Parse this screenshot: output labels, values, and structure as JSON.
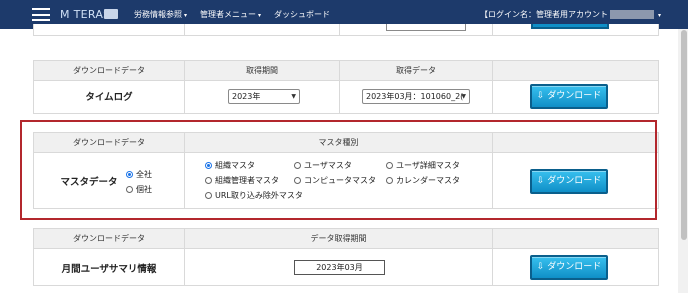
{
  "header": {
    "brand": "M TERAS",
    "nav": [
      {
        "label": "労務情報参照"
      },
      {
        "label": "管理者メニュー"
      },
      {
        "label": "ダッシュボード"
      }
    ],
    "login_label": "【ログイン名：管理者用アカウント"
  },
  "timelog": {
    "col_download_data": "ダウンロードデータ",
    "col_period": "取得期間",
    "col_data": "取得データ",
    "row_label": "タイムログ",
    "year_select": "2023年",
    "data_select": "2023年03月：101060_2(",
    "download": "ダウンロード"
  },
  "master": {
    "col_download_data": "ダウンロードデータ",
    "col_type": "マスタ種別",
    "row_label": "マスタデータ",
    "scope": [
      {
        "label": "全社",
        "selected": true
      },
      {
        "label": "個社",
        "selected": false
      }
    ],
    "types": [
      {
        "label": "組織マスタ",
        "selected": true
      },
      {
        "label": "ユーザマスタ",
        "selected": false
      },
      {
        "label": "ユーザ詳細マスタ",
        "selected": false
      },
      {
        "label": "組織管理者マスタ",
        "selected": false
      },
      {
        "label": "コンピュータマスタ",
        "selected": false
      },
      {
        "label": "カレンダーマスタ",
        "selected": false
      },
      {
        "label": "URL取り込み除外マスタ",
        "selected": false
      }
    ],
    "download": "ダウンロード"
  },
  "monthly": {
    "col_download_data": "ダウンロードデータ",
    "col_period": "データ取得期間",
    "row_label": "月間ユーザサマリ情報",
    "month": "2023年03月",
    "download": "ダウンロード"
  },
  "icons": {
    "download": "download-icon"
  }
}
